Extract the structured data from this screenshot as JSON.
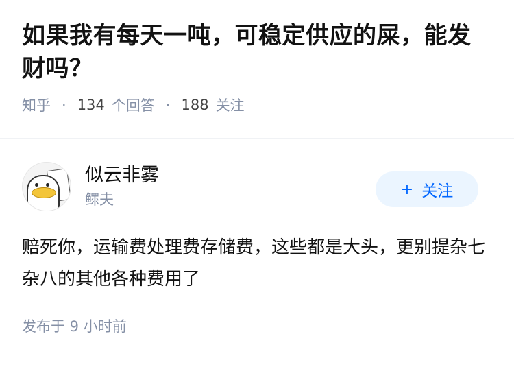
{
  "question": {
    "title": "如果我有每天一吨，可稳定供应的屎，能发财吗？",
    "source": "知乎",
    "answer_count": "134",
    "answer_label": "个回答",
    "follower_count": "188",
    "follower_label": "关注"
  },
  "answer": {
    "author_name": "似云非雾",
    "author_headline": "鳏夫",
    "follow_plus": "+",
    "follow_label": "关注",
    "content": "赔死你，运输费处理费存储费，这些都是大头，更别提杂七杂八的其他各种费用了",
    "time": "发布于  9 小时前"
  },
  "colors": {
    "accent": "#0066ff",
    "follow_bg": "#ebf5ff",
    "meta_gray": "#8590a6"
  }
}
